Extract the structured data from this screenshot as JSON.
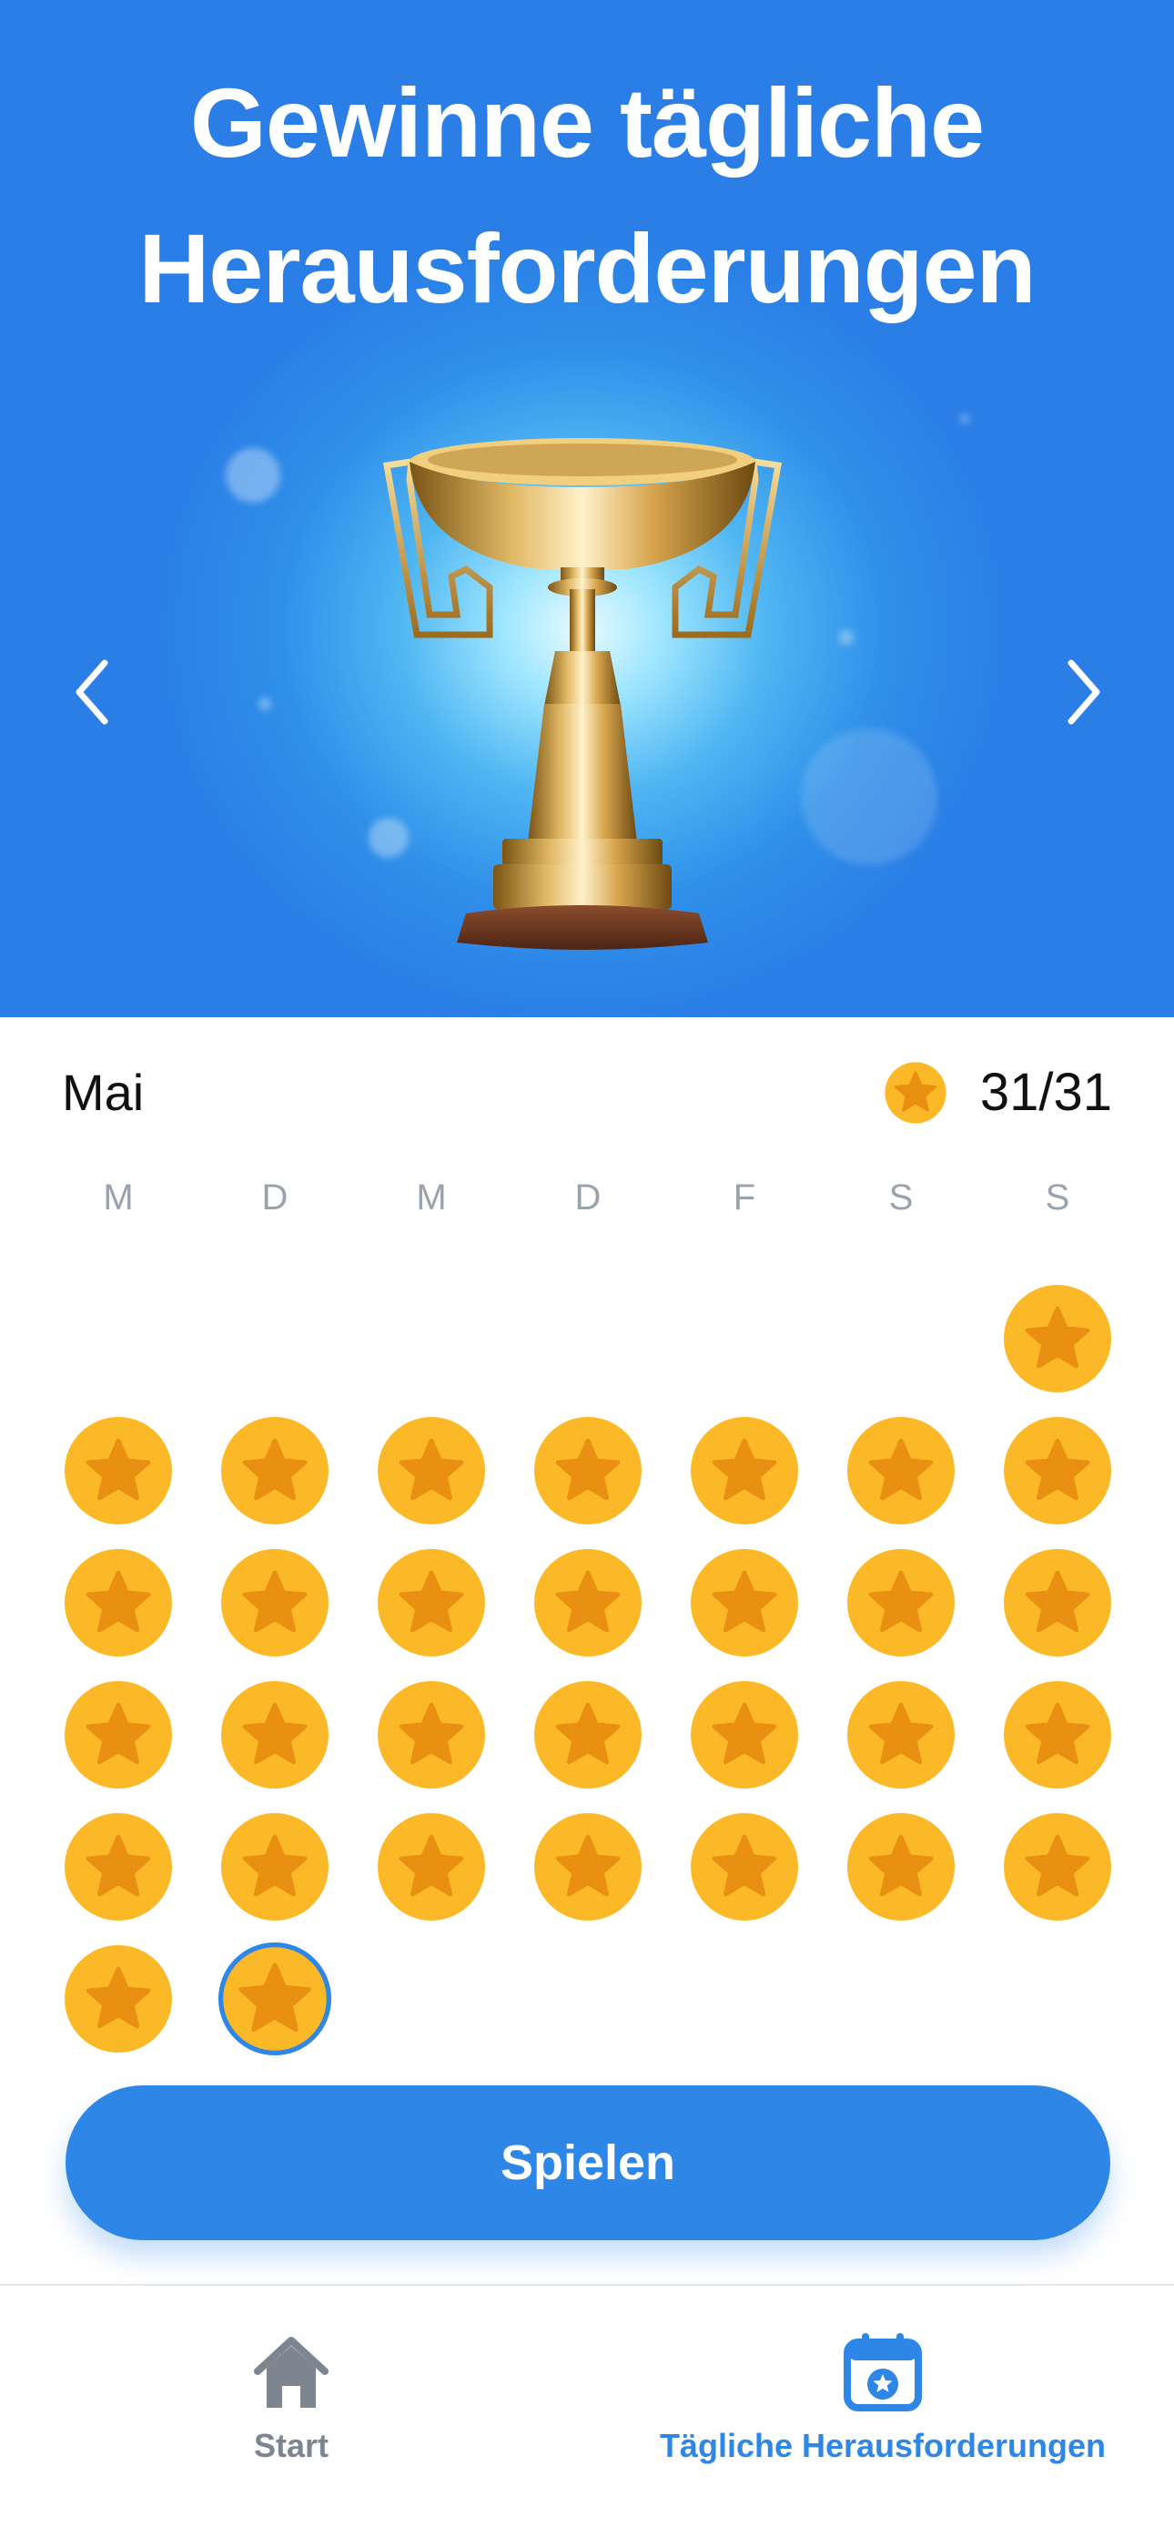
{
  "header": {
    "title_line1": "Gewinne tägliche",
    "title_line2": "Herausforderungen"
  },
  "calendar": {
    "month": "Mai",
    "completed": 31,
    "total": 31,
    "progress_text": "31/31",
    "weekdays": [
      "M",
      "D",
      "M",
      "D",
      "F",
      "S",
      "S"
    ],
    "first_weekday_index": 6,
    "days_in_month": 31,
    "today": 31,
    "completed_days": [
      1,
      2,
      3,
      4,
      5,
      6,
      7,
      8,
      9,
      10,
      11,
      12,
      13,
      14,
      15,
      16,
      17,
      18,
      19,
      20,
      21,
      22,
      23,
      24,
      25,
      26,
      27,
      28,
      29,
      30,
      31
    ]
  },
  "play_button": {
    "label": "Spielen"
  },
  "tabbar": {
    "items": [
      {
        "label": "Start",
        "icon": "home-icon",
        "active": false
      },
      {
        "label": "Tägliche Herausforderungen",
        "icon": "calendar-star-icon",
        "active": true
      }
    ]
  },
  "colors": {
    "accent": "#2e86e6",
    "coin": "#fbb928",
    "star": "#e98f12",
    "inactive_tab": "#7d8690"
  }
}
